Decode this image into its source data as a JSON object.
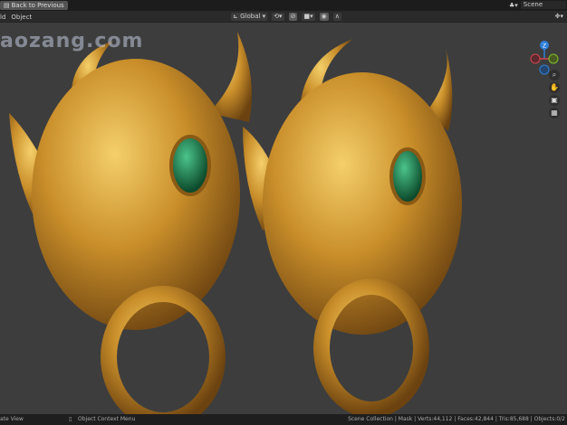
{
  "topbar": {
    "back_label": "Back to Previous",
    "scene_label": "Scene"
  },
  "header": {
    "menu": [
      "ld",
      "Object"
    ],
    "orientation": "Global"
  },
  "viewport": {
    "watermark": "aozang.com",
    "gizmo_axis": "Z",
    "colors": {
      "x": "#d8424f",
      "y": "#7fbf2a",
      "z": "#2f7fd9",
      "gold": "#d6a23a",
      "gem": "#1f8a55"
    }
  },
  "status": {
    "left": "ate View",
    "middle": "Object Context Menu",
    "right": "Scene Collection | Mask | Verts:44,112 | Faces:42,844 | Tris:85,688 | Objects:0/2"
  }
}
